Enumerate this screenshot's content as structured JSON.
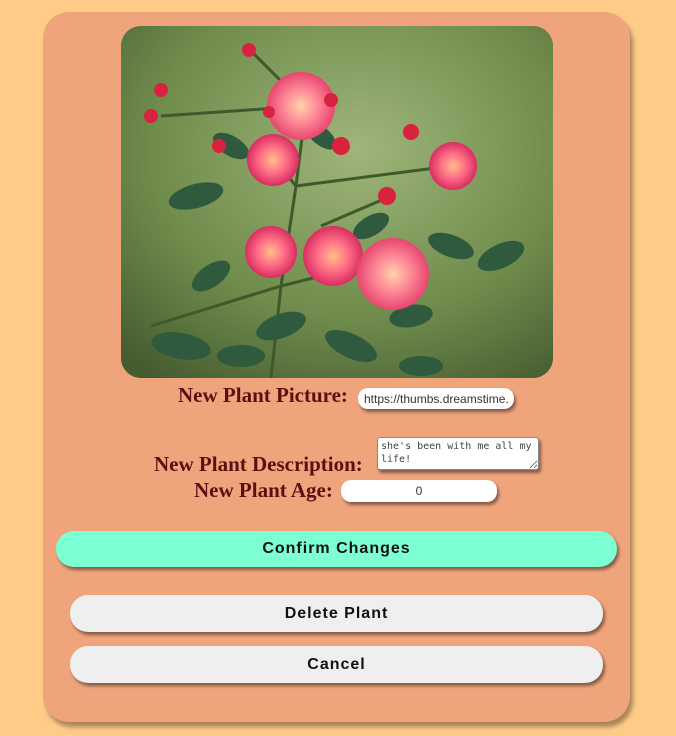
{
  "form": {
    "picture_label": "New Plant Picture:",
    "picture_value": "https://thumbs.dreamstime.com",
    "description_label": "New Plant Description:",
    "description_value": "she's been with me all my life!",
    "age_label": "New Plant Age:",
    "age_value": "0"
  },
  "buttons": {
    "confirm": "Confirm Changes",
    "delete": "Delete Plant",
    "cancel": "Cancel"
  },
  "colors": {
    "page_background": "#ffcc88",
    "card_background": "#f0a47c",
    "label_text": "#5a1010",
    "confirm_button": "#7cffd2",
    "plain_button": "#efefef"
  }
}
